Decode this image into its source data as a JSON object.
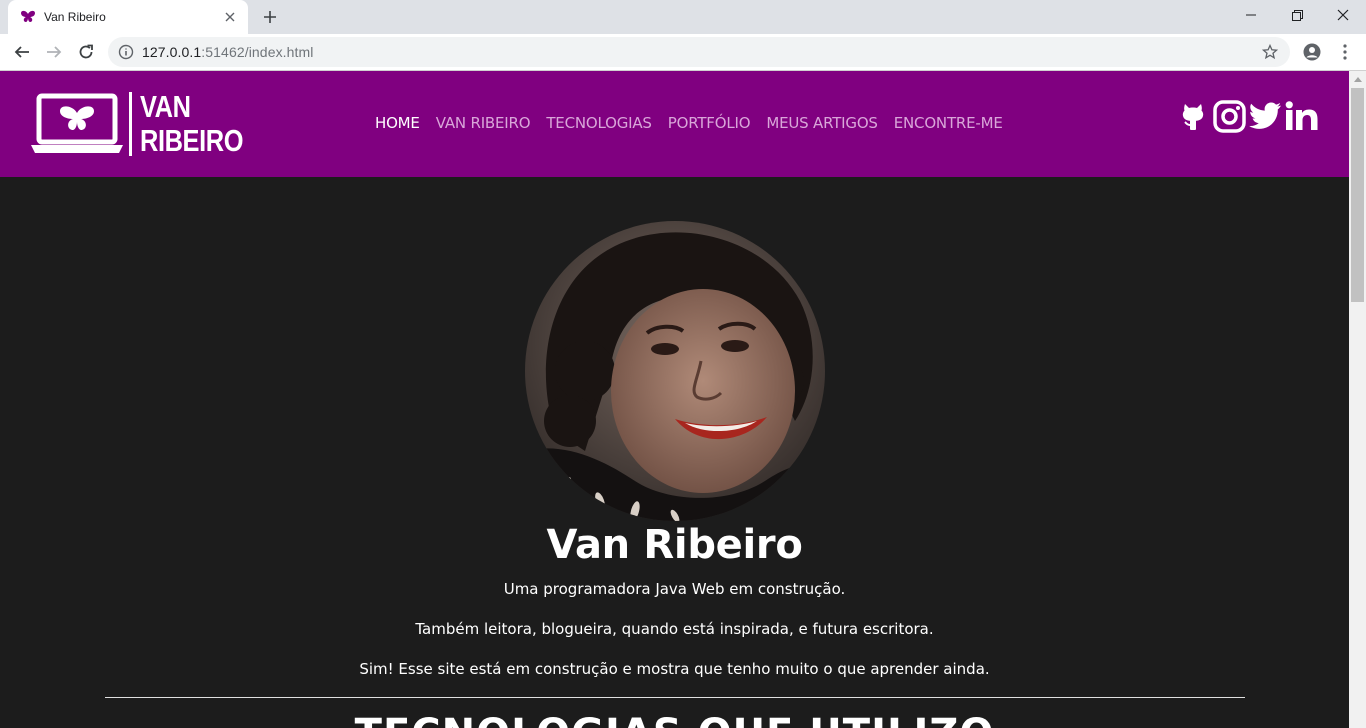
{
  "browser": {
    "tab_title": "Van Ribeiro",
    "url_host": "127.0.0.1",
    "url_path": ":51462/index.html"
  },
  "site": {
    "logo_line1": "VAN",
    "logo_line2": "RIBEIRO",
    "nav": [
      {
        "label": "HOME",
        "active": true
      },
      {
        "label": "VAN RIBEIRO",
        "active": false
      },
      {
        "label": "TECNOLOGIAS",
        "active": false
      },
      {
        "label": "PORTFÓLIO",
        "active": false
      },
      {
        "label": "MEUS ARTIGOS",
        "active": false
      },
      {
        "label": "ENCONTRE-ME",
        "active": false
      }
    ],
    "social_icons": [
      "github-icon",
      "instagram-icon",
      "twitter-icon",
      "linkedin-icon"
    ],
    "accent_color": "#800080",
    "background_color": "#1c1c1c"
  },
  "hero": {
    "name": "Van Ribeiro",
    "line1": "Uma programadora Java Web em construção.",
    "line2": "Também leitora, blogueira, quando está inspirada, e futura escritora.",
    "line3": "Sim! Esse site está em construção e mostra que tenho muito o que aprender ainda."
  },
  "section": {
    "title": "TECNOLOGIAS QUE UTILIZO"
  }
}
